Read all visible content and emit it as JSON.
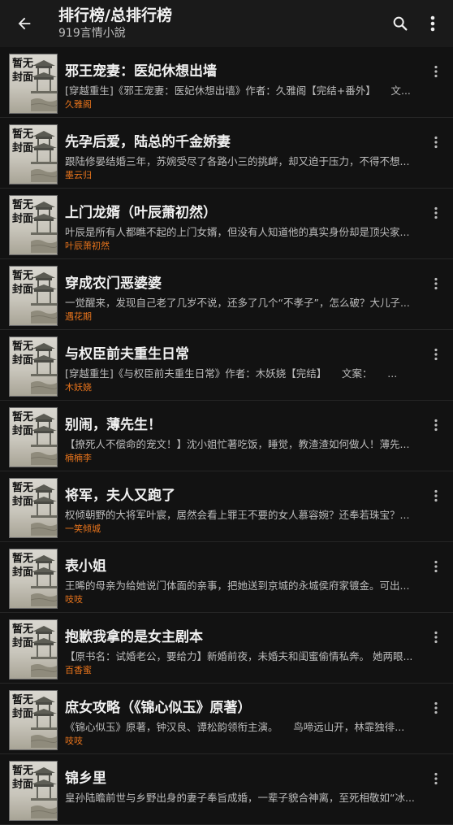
{
  "header": {
    "title": "排行榜/总排行榜",
    "subtitle": "919言情小說",
    "icons": {
      "back": "arrow-back-icon",
      "search": "search-icon",
      "more": "more-vert-icon"
    }
  },
  "cover_placeholder": "暂无封面",
  "colors": {
    "background": "#121212",
    "author": "#e8741c",
    "title": "#f0f0f0",
    "desc": "#bdbdbd"
  },
  "books": [
    {
      "title": "邪王宠妻：医妃休想出墙",
      "desc": "[穿越重生]《邪王宠妻：医妃休想出墙》作者：久雅阁【完结+番外】　　文...",
      "author": "久雅阁"
    },
    {
      "title": "先孕后爱，陆总的千金娇妻",
      "desc": "跟陆修晏结婚三年，苏婉受尽了各路小三的挑衅，却又迫于压力，不得不想...",
      "author": "墨云归"
    },
    {
      "title": "上门龙婿（叶辰萧初然）",
      "desc": "叶辰是所有人都瞧不起的上门女婿，但没有人知道他的真实身份却是顶尖家...",
      "author": "叶辰萧初然"
    },
    {
      "title": "穿成农门恶婆婆",
      "desc": "一觉醒来，发现自己老了几岁不说，还多了几个“不孝子”，怎么破？大儿子...",
      "author": "遇花期"
    },
    {
      "title": "与权臣前夫重生日常",
      "desc": "[穿越重生]《与权臣前夫重生日常》作者：木妖娆【完结】　　文案：　　...",
      "author": "木妖娆"
    },
    {
      "title": "别闹，薄先生！",
      "desc": "【撩死人不偿命的宠文！】沈小姐忙著吃饭，睡觉，教渣渣如何做人！薄先...",
      "author": "楠楠李"
    },
    {
      "title": "将军，夫人又跑了",
      "desc": "权倾朝野的大将军叶宸，居然会看上罪王不要的女人慕容婉？还奉若珠宝？...",
      "author": "一笑倾城"
    },
    {
      "title": "表小姐",
      "desc": "王晞的母亲为给她说门体面的亲事，把她送到京城的永城侯府家镀金。可出...",
      "author": "吱吱"
    },
    {
      "title": "抱歉我拿的是女主剧本",
      "desc": "【原书名：试婚老公，要给力】新婚前夜，未婚夫和闺蜜偷情私奔。 她两眼...",
      "author": "百香蜜"
    },
    {
      "title": "庶女攻略（《锦心似玉》原著）",
      "desc": "《锦心似玉》原著，钟汉良、谭松韵领衔主演。　　鸟啼远山开，林霏独徘...",
      "author": "吱吱"
    },
    {
      "title": "锦乡里",
      "desc": "皇孙陆瞻前世与乡野出身的妻子奉旨成婚，一辈子貌合神离，至死相敬如“冰...",
      "author": ""
    }
  ]
}
